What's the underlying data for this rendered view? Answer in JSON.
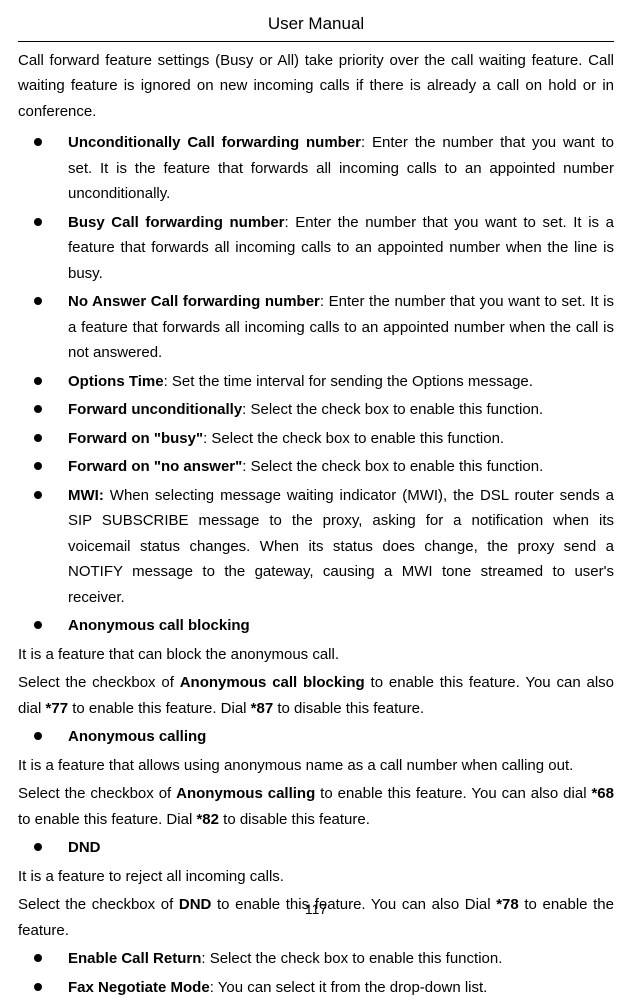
{
  "header": "User Manual",
  "intro": "Call forward feature settings (Busy or All) take priority over the call waiting feature. Call waiting feature is ignored on new incoming calls if there is already a call on hold or in conference.",
  "bullets": {
    "b1_title": "Unconditionally Call forwarding number",
    "b1_text": ": Enter the number that you want to set. It is the feature that forwards all incoming calls to an appointed number unconditionally.",
    "b2_title": "Busy Call forwarding number",
    "b2_text": ": Enter the number that you want to set. It is a feature that forwards all incoming calls to an appointed number when the line is busy.",
    "b3_title": "No Answer Call forwarding number",
    "b3_text": ": Enter the number that you want to set. It is a feature that forwards all incoming calls to an appointed number when the call is not answered.",
    "b4_title": "Options Time",
    "b4_text": ": Set the time interval for sending the Options message.",
    "b5_title": "Forward unconditionally",
    "b5_text": ": Select the check box to enable this function.",
    "b6_title": "Forward on \"busy\"",
    "b6_text": ": Select the check box to enable this function.",
    "b7_title": "Forward on \"no answer\"",
    "b7_text": ": Select the check box to enable this function.",
    "b8_title": "MWI:",
    "b8_text": " When selecting message waiting indicator (MWI), the DSL router sends a SIP SUBSCRIBE message to the proxy, asking for a notification when its voicemail status changes. When its status does change, the proxy send a NOTIFY message to the gateway, causing a MWI tone streamed to user's receiver.",
    "b9_title": "Anonymous call blocking",
    "b10_title": "Anonymous calling",
    "b11_title": "DND",
    "b12_title": "Enable Call Return",
    "b12_text": ": Select the check box to enable this function.",
    "b13_title": "Fax Negotiate Mode",
    "b13_text": ": You can select it from the drop-down list."
  },
  "sections": {
    "s1": "It is a feature that can block the anonymous call.",
    "s2a": "Select the checkbox of ",
    "s2b": "Anonymous call blocking",
    "s2c": " to enable this feature. You can also dial ",
    "s2d": "*77",
    "s2e": " to enable this feature. Dial ",
    "s2f": "*87",
    "s2g": " to disable this feature.",
    "s3": "It is a feature that allows using anonymous name as a call number when calling out.",
    "s4a": "Select the checkbox of ",
    "s4b": "Anonymous calling",
    "s4c": " to enable this feature. You can also dial ",
    "s4d": "*68",
    "s4e": " to enable this feature. Dial ",
    "s4f": "*82",
    "s4g": " to disable this feature.",
    "s5": "It is a feature to reject all incoming calls.",
    "s6a": "Select the checkbox of ",
    "s6b": "DND",
    "s6c": " to enable this feature. You can also Dial ",
    "s6d": "*78",
    "s6e": " to enable the feature."
  },
  "page_number": "117"
}
